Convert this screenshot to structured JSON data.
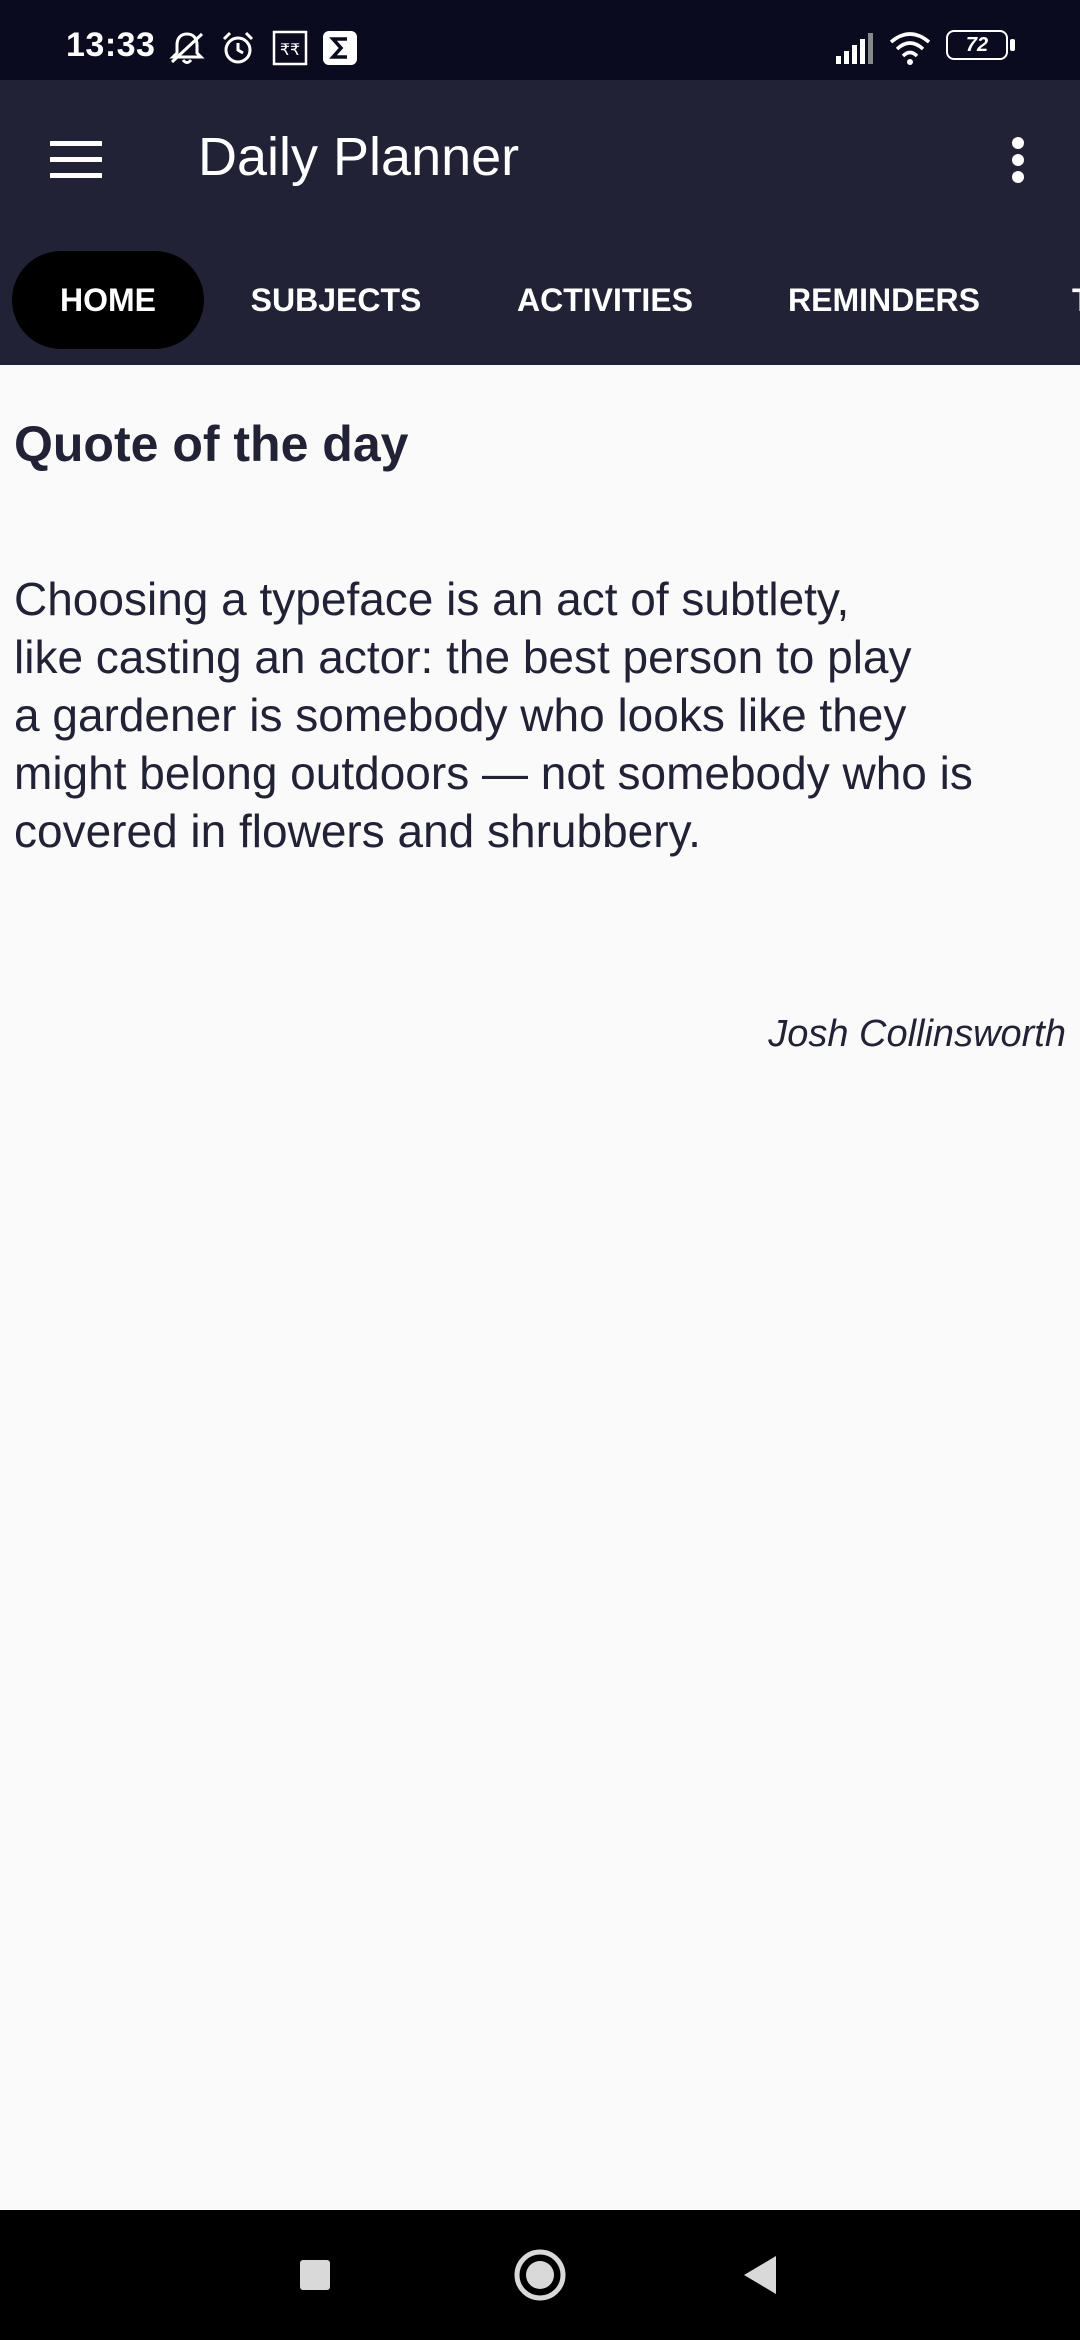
{
  "status_bar": {
    "time": "13:33",
    "battery": "72",
    "icons": [
      "notifications-muted-icon",
      "alarm-icon",
      "rupee-icon",
      "sigma-icon",
      "signal-icon",
      "wifi-icon",
      "battery-icon"
    ]
  },
  "app_bar": {
    "title": "Daily Planner",
    "menu_icon": "hamburger-menu-icon",
    "overflow_icon": "more-vert-icon"
  },
  "tabs": [
    {
      "label": "HOME",
      "active": true
    },
    {
      "label": "SUBJECTS",
      "active": false
    },
    {
      "label": "ACTIVITIES",
      "active": false
    },
    {
      "label": "REMINDERS",
      "active": false
    },
    {
      "label": "T",
      "active": false
    }
  ],
  "quote": {
    "heading": "Quote of the day",
    "lines": [
      "Choosing a typeface is an act of subtlety,",
      "like casting an actor: the best person to play",
      "a gardener is somebody who looks like they",
      "might belong outdoors — not somebody who is",
      "covered in flowers and shrubbery."
    ],
    "author": "Josh Collinsworth"
  },
  "nav_bar": {
    "icons": [
      "recents-square-icon",
      "home-circle-icon",
      "back-triangle-icon"
    ]
  },
  "colors": {
    "status_bar_bg": "#0b0b1f",
    "app_bar_bg": "#222236",
    "active_tab_bg": "#000000",
    "content_bg": "#fafafa",
    "text_dark": "#222236"
  }
}
